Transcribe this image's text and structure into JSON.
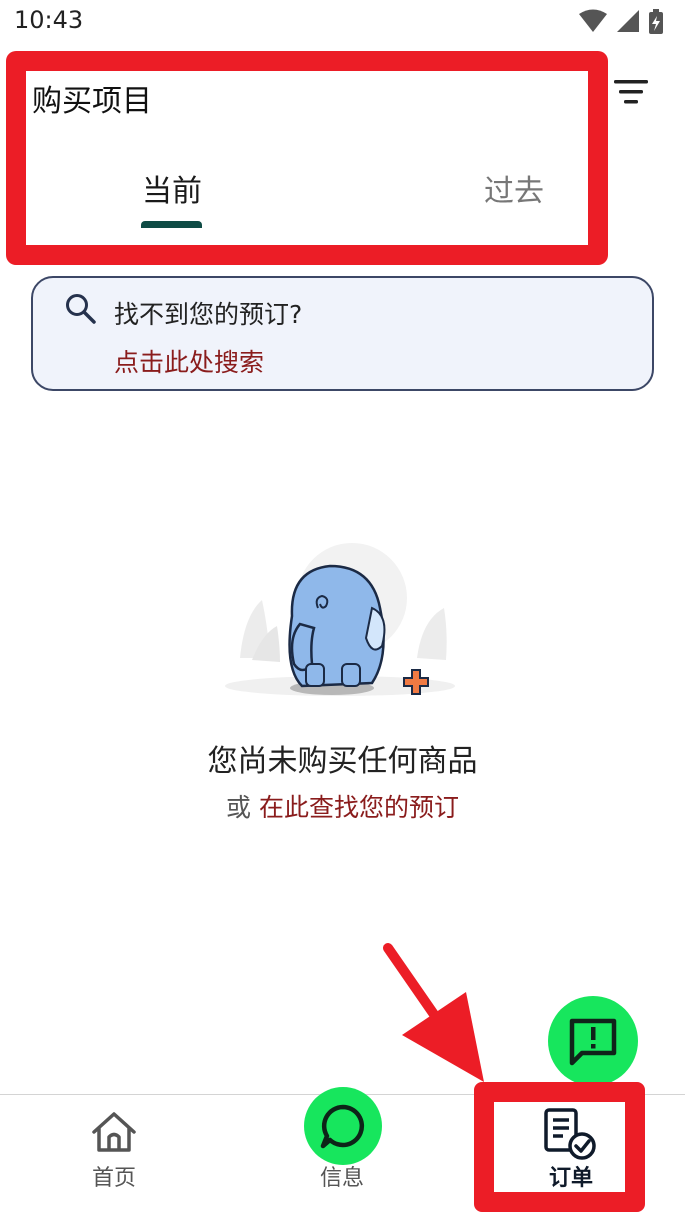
{
  "status_bar": {
    "time": "10:43"
  },
  "header": {
    "title": "购买项目",
    "tabs": [
      {
        "label": "当前",
        "active": true
      },
      {
        "label": "过去",
        "active": false
      }
    ]
  },
  "search_card": {
    "question": "找不到您的预订?",
    "link": "点击此处搜索"
  },
  "empty_state": {
    "title": "您尚未购买任何商品",
    "or_text": "或",
    "link": "在此查找您的预订"
  },
  "bottom_nav": {
    "items": [
      {
        "label": "首页",
        "icon": "home-icon"
      },
      {
        "label": "信息",
        "icon": "chat-bubble-icon"
      },
      {
        "label": "订单",
        "icon": "orders-icon",
        "active": true
      }
    ]
  },
  "colors": {
    "accent_green": "#17e65d",
    "tab_underline": "#0e4b45",
    "link_red": "#8a1c1c",
    "annotation_red": "#ec1d26"
  }
}
